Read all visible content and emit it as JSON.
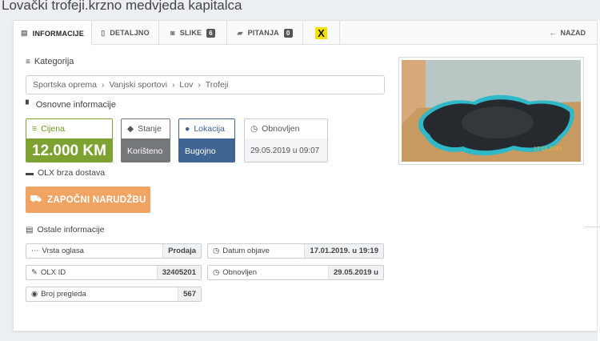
{
  "page_title": "Lovački trofeji.krzno medvjeda kapitalca",
  "tabs": [
    {
      "label": "INFORMACIJE",
      "icon": "id-card-icon"
    },
    {
      "label": "DETALJNO",
      "icon": "document-icon"
    },
    {
      "label": "SLIKE",
      "badge": "6",
      "icon": "camera-icon"
    },
    {
      "label": "PITANJA",
      "badge": "0",
      "icon": "chat-icon"
    }
  ],
  "bank_logo_glyph": "X",
  "back_label": "NAZAD",
  "category": {
    "heading": "Kategorija",
    "crumbs": [
      "Sportska oprema",
      "Vanjski sportovi",
      "Lov",
      "Trofeji"
    ]
  },
  "basic_info": {
    "heading": "Osnovne informacije",
    "price": {
      "label": "Cijena",
      "value": "12.000 KM"
    },
    "condition": {
      "label": "Stanje",
      "value": "Korišteno"
    },
    "location": {
      "label": "Lokacija",
      "value": "Bugojno"
    },
    "updated": {
      "label": "Obnovljen",
      "value": "29.05.2019 u 09:07"
    }
  },
  "delivery": {
    "label": "OLX brza dostava",
    "button_label": "ZAPOČNI NARUDŽBU"
  },
  "other_info": {
    "heading": "Ostale informacije",
    "ad_type": {
      "label": "Vrsta oglasa",
      "value": "Prodaja"
    },
    "published": {
      "label": "Datum objave",
      "value": "17.01.2019. u 19:19"
    },
    "olx_id": {
      "label": "OLX ID",
      "value": "32405201"
    },
    "updated2": {
      "label": "Obnovljen",
      "value": "29.05.2019 u"
    },
    "views": {
      "label": "Broj pregleda",
      "value": "567"
    }
  },
  "photo": {
    "date_stamp": "17 01 2019"
  },
  "colors": {
    "price_green": "#7da232",
    "location_blue": "#3f6594",
    "condition_gray": "#74787b",
    "button_orange": "#f0a464",
    "bank_yellow": "#f4e300"
  }
}
